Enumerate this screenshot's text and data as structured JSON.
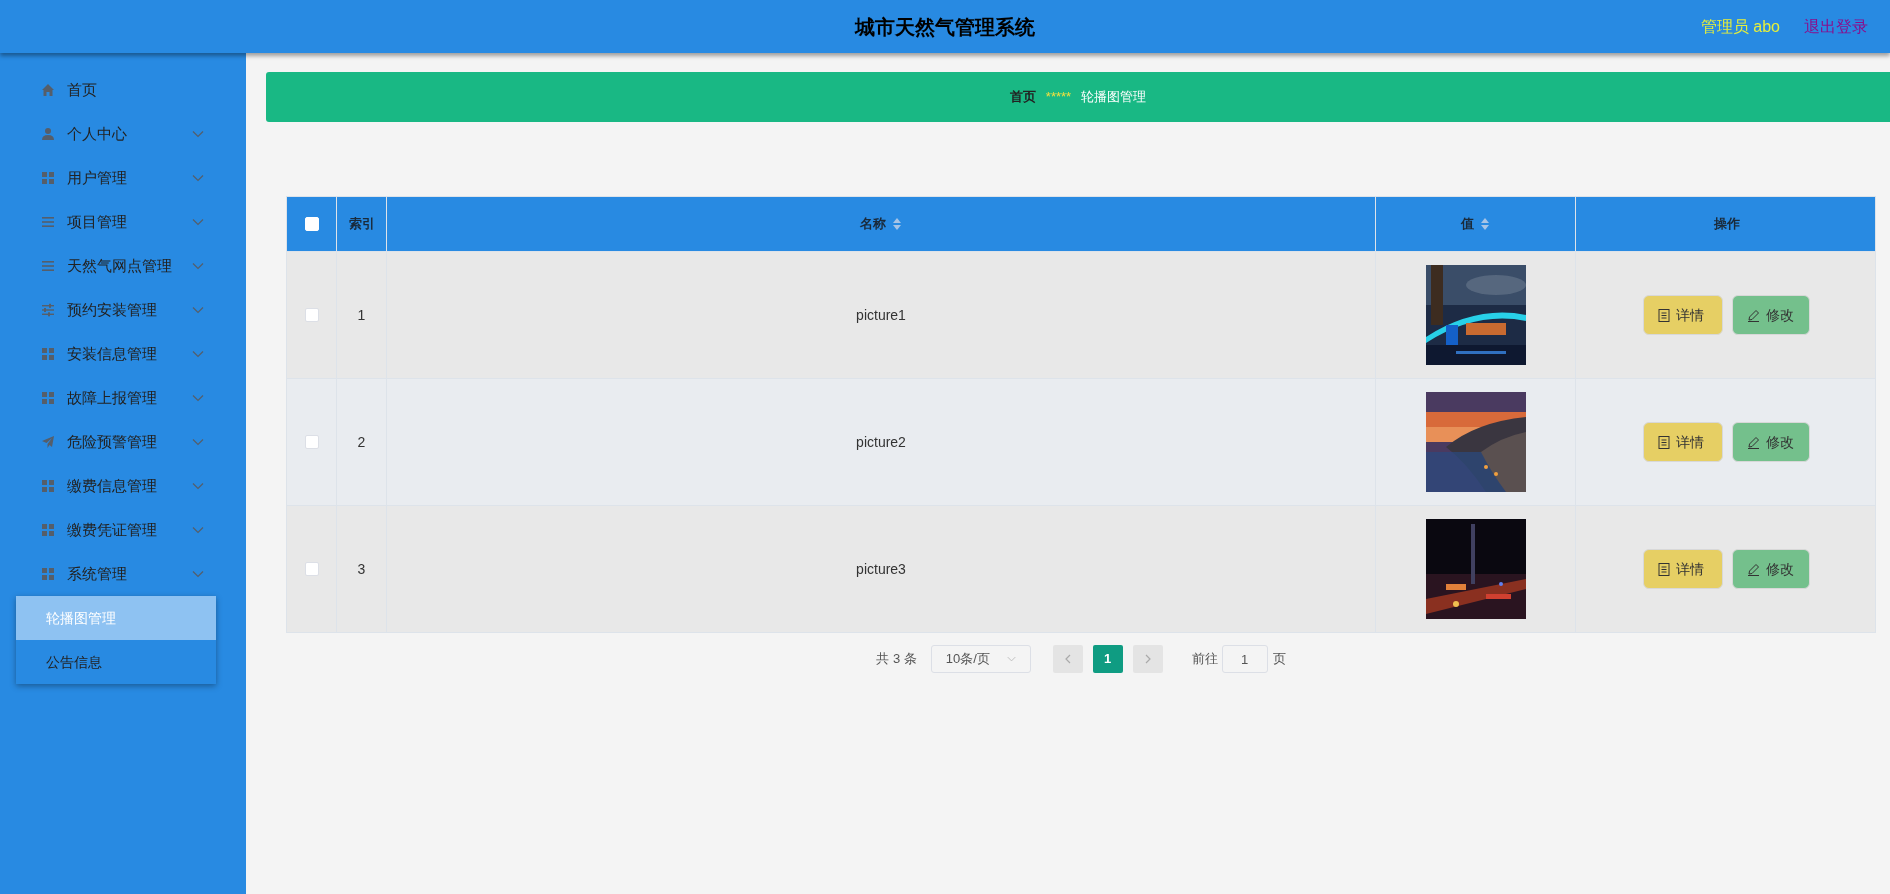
{
  "header": {
    "title": "城市天然气管理系统",
    "user": "管理员 abo",
    "logout": "退出登录"
  },
  "sidebar": {
    "items": [
      {
        "label": "首页",
        "kind": "link"
      },
      {
        "label": "个人中心",
        "kind": "menu"
      },
      {
        "label": "用户管理",
        "kind": "menu"
      },
      {
        "label": "项目管理",
        "kind": "menu"
      },
      {
        "label": "天然气网点管理",
        "kind": "menu"
      },
      {
        "label": "预约安装管理",
        "kind": "menu"
      },
      {
        "label": "安装信息管理",
        "kind": "menu"
      },
      {
        "label": "故障上报管理",
        "kind": "menu"
      },
      {
        "label": "危险预警管理",
        "kind": "menu"
      },
      {
        "label": "缴费信息管理",
        "kind": "menu"
      },
      {
        "label": "缴费凭证管理",
        "kind": "menu"
      },
      {
        "label": "系统管理",
        "kind": "menu",
        "children": [
          {
            "label": "轮播图管理",
            "selected": true
          },
          {
            "label": "公告信息",
            "selected": false
          }
        ]
      }
    ]
  },
  "breadcrumb": {
    "home": "首页",
    "separator": "*****",
    "current": "轮播图管理"
  },
  "table": {
    "columns": [
      {
        "label": "索引",
        "sortable": false
      },
      {
        "label": "名称",
        "sortable": true
      },
      {
        "label": "值",
        "sortable": true
      },
      {
        "label": "操作",
        "sortable": false
      }
    ],
    "header_checked": false,
    "rows": [
      {
        "index": "1",
        "name": "picture1",
        "checked": false,
        "value": {
          "kind": "picture"
        },
        "actions": [
          "详情",
          "修改"
        ]
      },
      {
        "index": "2",
        "name": "picture2",
        "checked": false,
        "value": {
          "kind": "picture"
        },
        "actions": [
          "详情",
          "修改"
        ]
      },
      {
        "index": "3",
        "name": "picture3",
        "checked": false,
        "value": {
          "kind": "picture"
        },
        "actions": [
          "详情",
          "修改"
        ]
      }
    ]
  },
  "pagination": {
    "total": "共 3 条",
    "page_size": "10条/页",
    "pages": [
      {
        "label": "1",
        "selected": true
      }
    ],
    "goto_label": "前往",
    "goto_value": "1",
    "goto_suffix": "页"
  }
}
